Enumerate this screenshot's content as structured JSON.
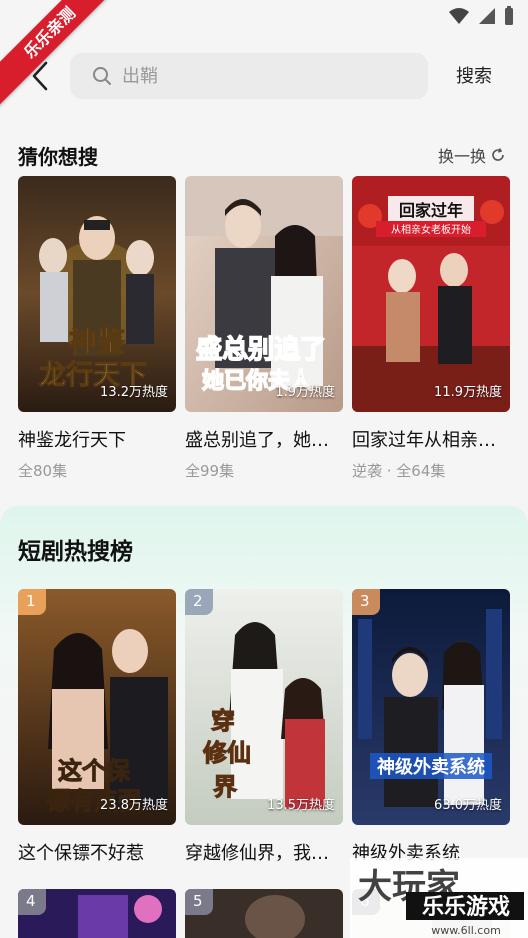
{
  "ribbon": {
    "text": "乐乐亲测"
  },
  "search": {
    "placeholder": "出鞘",
    "button_label": "搜索"
  },
  "guess": {
    "title": "猜你想搜",
    "refresh_label": "换一换",
    "items": [
      {
        "poster_text": "神鉴 龙行天下",
        "heat": "13.2万热度",
        "title": "神鉴龙行天下",
        "sub": "全80集"
      },
      {
        "poster_text": "盛总别追了 她已你夫人",
        "heat": "1.9万热度",
        "title": "盛总别追了，她…",
        "sub": "全99集"
      },
      {
        "poster_text": "回家过年 从相亲女老板开始",
        "heat": "11.9万热度",
        "title": "回家过年从相亲…",
        "sub": "逆袭 · 全64集"
      }
    ]
  },
  "hot": {
    "title": "短剧热搜榜",
    "items": [
      {
        "rank": "1",
        "poster_text": "这个保镖有点强",
        "heat": "23.8万热度",
        "title": "这个保镖不好惹"
      },
      {
        "rank": "2",
        "poster_text": "穿越修仙界",
        "heat": "13.5万热度",
        "title": "穿越修仙界，我…"
      },
      {
        "rank": "3",
        "poster_text": "神级外卖系统",
        "heat": "63.0万热度",
        "title": "神级外卖系统"
      },
      {
        "rank": "4"
      },
      {
        "rank": "5"
      },
      {
        "rank": "6"
      }
    ]
  },
  "watermark": {
    "text": "大玩家 乐乐游戏 www.6ll.com"
  },
  "colors": {
    "accent_red": "#d81e2c",
    "rank1": "#e8a05a",
    "rank2": "#9aa7b8",
    "rank3": "#c98a5e"
  }
}
